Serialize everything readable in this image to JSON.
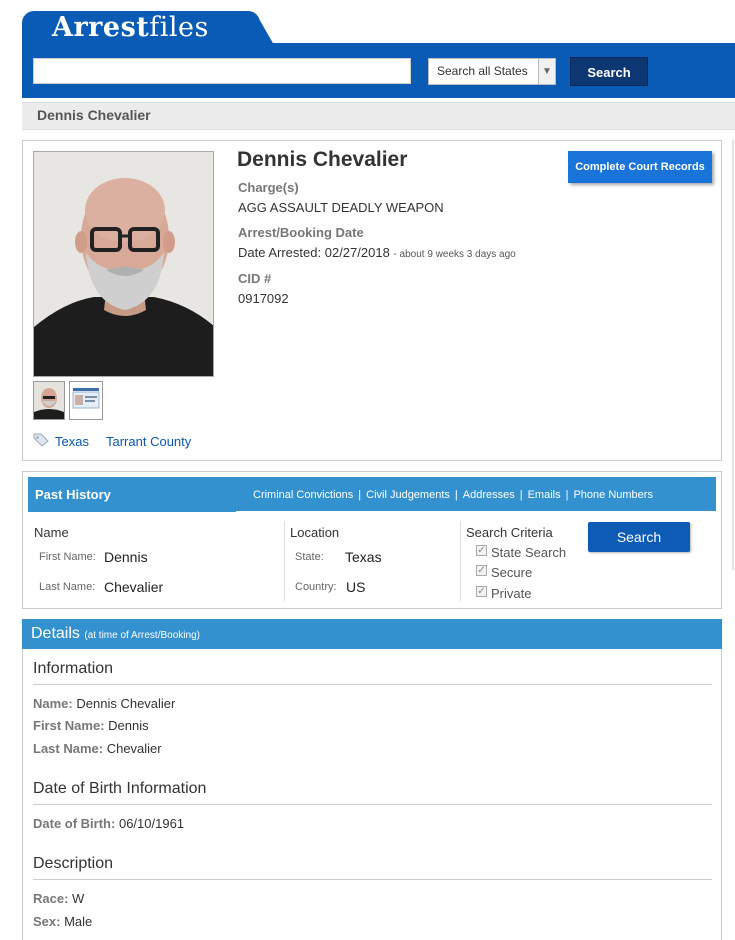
{
  "header": {
    "logo_bold": "Arrest",
    "logo_light": "files",
    "search_value": "",
    "state_select": "Search all States",
    "search_button": "Search"
  },
  "breadcrumb": "Dennis Chevalier",
  "profile": {
    "name": "Dennis Chevalier",
    "charge_label": "Charge(s)",
    "charge": "AGG ASSAULT DEADLY WEAPON",
    "booking_label": "Arrest/Booking Date",
    "date_arrested_label": "Date Arrested:",
    "date_arrested": "02/27/2018",
    "date_relative": "- about 9 weeks 3 days ago",
    "cid_label": "CID #",
    "cid": "0917092",
    "court_button": "Complete Court Records",
    "tag_state": "Texas",
    "tag_county": "Tarrant County"
  },
  "history": {
    "title": "Past History",
    "links": [
      "Criminal Convictions",
      "Civil Judgements",
      "Addresses",
      "Emails",
      "Phone Numbers"
    ],
    "name_header": "Name",
    "first_name_label": "First Name:",
    "first_name": "Dennis",
    "last_name_label": "Last Name:",
    "last_name": "Chevalier",
    "location_header": "Location",
    "state_label": "State:",
    "state": "Texas",
    "country_label": "Country:",
    "country": "US",
    "criteria_header": "Search Criteria",
    "criteria": [
      "State Search",
      "Secure",
      "Private"
    ],
    "search_button": "Search"
  },
  "details": {
    "title": "Details",
    "subtitle": "(at time of Arrest/Booking)",
    "information_header": "Information",
    "name_label": "Name:",
    "name": "Dennis Chevalier",
    "first_name_label": "First Name:",
    "first_name": "Dennis",
    "last_name_label": "Last Name:",
    "last_name": "Chevalier",
    "dob_header": "Date of Birth Information",
    "dob_label": "Date of Birth:",
    "dob": "06/10/1961",
    "description_header": "Description",
    "race_label": "Race:",
    "race": "W",
    "sex_label": "Sex:",
    "sex": "Male"
  },
  "colors": {
    "brand_blue": "#0a5bb5",
    "bar_blue": "#3391cf",
    "link_blue": "#0a56b0"
  }
}
